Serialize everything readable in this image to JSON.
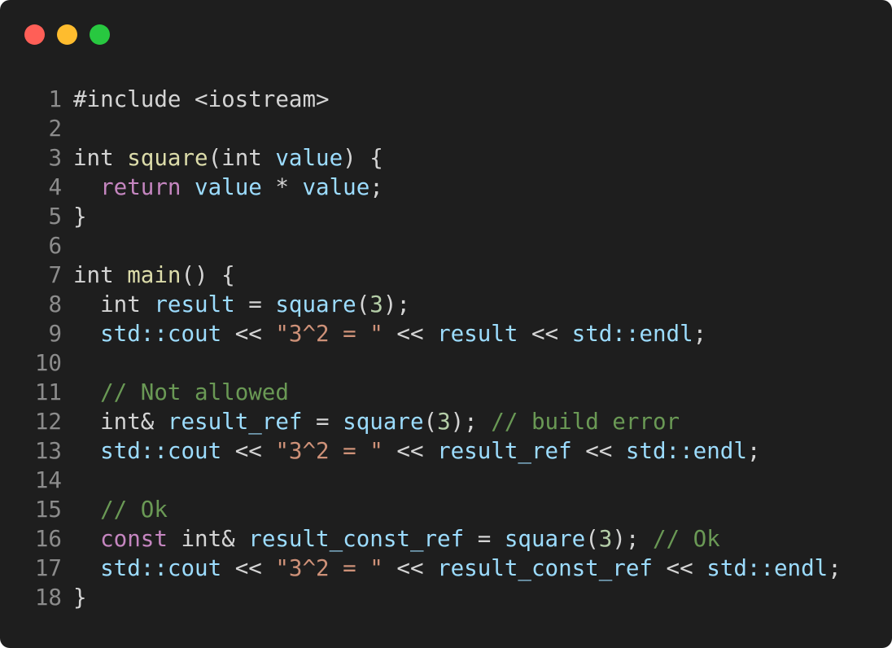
{
  "window": {
    "buttons": [
      {
        "name": "close",
        "color": "#ff5f57"
      },
      {
        "name": "minimize",
        "color": "#febc2e"
      },
      {
        "name": "zoom",
        "color": "#28c840"
      }
    ]
  },
  "code": {
    "lines": [
      {
        "number": "1",
        "tokens": [
          {
            "t": "#include <iostream>",
            "k": "plain"
          }
        ]
      },
      {
        "number": "2",
        "tokens": []
      },
      {
        "number": "3",
        "tokens": [
          {
            "t": "int ",
            "k": "keyword"
          },
          {
            "t": "square",
            "k": "function"
          },
          {
            "t": "(int ",
            "k": "plain"
          },
          {
            "t": "value",
            "k": "variable"
          },
          {
            "t": ") {",
            "k": "plain"
          }
        ]
      },
      {
        "number": "4",
        "tokens": [
          {
            "t": "  ",
            "k": "plain"
          },
          {
            "t": "return",
            "k": "control"
          },
          {
            "t": " ",
            "k": "plain"
          },
          {
            "t": "value",
            "k": "variable"
          },
          {
            "t": " * ",
            "k": "operator"
          },
          {
            "t": "value",
            "k": "variable"
          },
          {
            "t": ";",
            "k": "plain"
          }
        ]
      },
      {
        "number": "5",
        "tokens": [
          {
            "t": "}",
            "k": "plain"
          }
        ]
      },
      {
        "number": "6",
        "tokens": []
      },
      {
        "number": "7",
        "tokens": [
          {
            "t": "int ",
            "k": "keyword"
          },
          {
            "t": "main",
            "k": "function"
          },
          {
            "t": "() {",
            "k": "plain"
          }
        ]
      },
      {
        "number": "8",
        "tokens": [
          {
            "t": "  int ",
            "k": "keyword"
          },
          {
            "t": "result",
            "k": "variable"
          },
          {
            "t": " = ",
            "k": "operator"
          },
          {
            "t": "square",
            "k": "variable"
          },
          {
            "t": "(",
            "k": "plain"
          },
          {
            "t": "3",
            "k": "number"
          },
          {
            "t": ");",
            "k": "plain"
          }
        ]
      },
      {
        "number": "9",
        "tokens": [
          {
            "t": "  ",
            "k": "plain"
          },
          {
            "t": "std::cout",
            "k": "variable"
          },
          {
            "t": " << ",
            "k": "operator"
          },
          {
            "t": "\"3^2 = \"",
            "k": "string"
          },
          {
            "t": " << ",
            "k": "operator"
          },
          {
            "t": "result",
            "k": "variable"
          },
          {
            "t": " << ",
            "k": "operator"
          },
          {
            "t": "std::endl",
            "k": "variable"
          },
          {
            "t": ";",
            "k": "plain"
          }
        ]
      },
      {
        "number": "10",
        "tokens": []
      },
      {
        "number": "11",
        "tokens": [
          {
            "t": "  ",
            "k": "plain"
          },
          {
            "t": "// Not allowed",
            "k": "comment"
          }
        ]
      },
      {
        "number": "12",
        "tokens": [
          {
            "t": "  int& ",
            "k": "keyword"
          },
          {
            "t": "result_ref",
            "k": "variable"
          },
          {
            "t": " = ",
            "k": "operator"
          },
          {
            "t": "square",
            "k": "variable"
          },
          {
            "t": "(",
            "k": "plain"
          },
          {
            "t": "3",
            "k": "number"
          },
          {
            "t": "); ",
            "k": "plain"
          },
          {
            "t": "// build error",
            "k": "comment"
          }
        ]
      },
      {
        "number": "13",
        "tokens": [
          {
            "t": "  ",
            "k": "plain"
          },
          {
            "t": "std::cout",
            "k": "variable"
          },
          {
            "t": " << ",
            "k": "operator"
          },
          {
            "t": "\"3^2 = \"",
            "k": "string"
          },
          {
            "t": " << ",
            "k": "operator"
          },
          {
            "t": "result_ref",
            "k": "variable"
          },
          {
            "t": " << ",
            "k": "operator"
          },
          {
            "t": "std::endl",
            "k": "variable"
          },
          {
            "t": ";",
            "k": "plain"
          }
        ]
      },
      {
        "number": "14",
        "tokens": []
      },
      {
        "number": "15",
        "tokens": [
          {
            "t": "  ",
            "k": "plain"
          },
          {
            "t": "// Ok",
            "k": "comment"
          }
        ]
      },
      {
        "number": "16",
        "tokens": [
          {
            "t": "  ",
            "k": "plain"
          },
          {
            "t": "const",
            "k": "control"
          },
          {
            "t": " int& ",
            "k": "keyword"
          },
          {
            "t": "result_const_ref",
            "k": "variable"
          },
          {
            "t": " = ",
            "k": "operator"
          },
          {
            "t": "square",
            "k": "variable"
          },
          {
            "t": "(",
            "k": "plain"
          },
          {
            "t": "3",
            "k": "number"
          },
          {
            "t": "); ",
            "k": "plain"
          },
          {
            "t": "// Ok",
            "k": "comment"
          }
        ]
      },
      {
        "number": "17",
        "tokens": [
          {
            "t": "  ",
            "k": "plain"
          },
          {
            "t": "std::cout",
            "k": "variable"
          },
          {
            "t": " << ",
            "k": "operator"
          },
          {
            "t": "\"3^2 = \"",
            "k": "string"
          },
          {
            "t": " << ",
            "k": "operator"
          },
          {
            "t": "result_const_ref",
            "k": "variable"
          },
          {
            "t": " << ",
            "k": "operator"
          },
          {
            "t": "std::endl",
            "k": "variable"
          },
          {
            "t": ";",
            "k": "plain"
          }
        ]
      },
      {
        "number": "18",
        "tokens": [
          {
            "t": "}",
            "k": "plain"
          }
        ]
      }
    ]
  }
}
